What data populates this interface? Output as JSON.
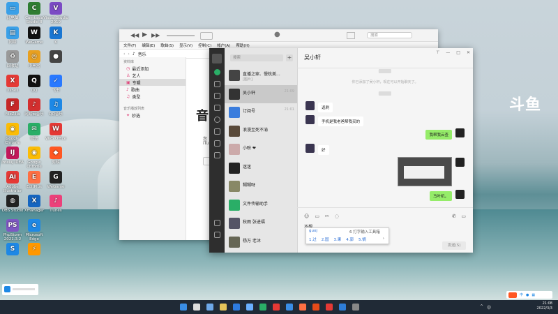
{
  "desktop": {
    "right_logo": "斗鱼",
    "icons": [
      {
        "label": "此电脑",
        "color": "#3aa0e8",
        "glyph": "▭",
        "col": 0,
        "row": 0
      },
      {
        "label": "Camtasia Studio 8",
        "color": "#2e7d32",
        "glyph": "C",
        "col": 1,
        "row": 0
      },
      {
        "label": "Visual Studio 2019",
        "color": "#7b4bc4",
        "glyph": "V",
        "col": 2,
        "row": 0
      },
      {
        "label": "网络",
        "color": "#3aa0e8",
        "glyph": "▤",
        "col": 0,
        "row": 1
      },
      {
        "label": "WeGame",
        "color": "#111",
        "glyph": "W",
        "col": 1,
        "row": 1
      },
      {
        "label": "K",
        "color": "#1976d2",
        "glyph": "K",
        "col": 2,
        "row": 1
      },
      {
        "label": "回收站",
        "color": "#999",
        "glyph": "♻",
        "col": 0,
        "row": 2
      },
      {
        "label": "小黑盒",
        "color": "#e8a020",
        "glyph": "◎",
        "col": 1,
        "row": 2
      },
      {
        "label": "",
        "color": "#444",
        "glyph": "●",
        "col": 2,
        "row": 2
      },
      {
        "label": "Xshell",
        "color": "#e53935",
        "glyph": "X",
        "col": 0,
        "row": 3
      },
      {
        "label": "QQ",
        "color": "#111",
        "glyph": "Q",
        "col": 1,
        "row": 3
      },
      {
        "label": "飞书",
        "color": "#2979ff",
        "glyph": "✓",
        "col": 2,
        "row": 3
      },
      {
        "label": "FileZilla",
        "color": "#c62828",
        "glyph": "F",
        "col": 0,
        "row": 4
      },
      {
        "label": "网易云音乐",
        "color": "#d32f2f",
        "glyph": "♪",
        "col": 1,
        "row": 4
      },
      {
        "label": "QQ音乐",
        "color": "#1e88e5",
        "glyph": "♫",
        "col": 2,
        "row": 4
      },
      {
        "label": "Google Chrome",
        "color": "#fbbc05",
        "glyph": "◉",
        "col": 0,
        "row": 5
      },
      {
        "label": "微信",
        "color": "#2aae67",
        "glyph": "✉",
        "col": 1,
        "row": 5
      },
      {
        "label": "WPS Office",
        "color": "#e53935",
        "glyph": "W",
        "col": 2,
        "row": 5
      },
      {
        "label": "IntelliJ IDEA",
        "color": "#c2185b",
        "glyph": "IJ",
        "col": 0,
        "row": 6
      },
      {
        "label": "Google Chrome",
        "color": "#fbbc05",
        "glyph": "◉",
        "col": 1,
        "row": 6
      },
      {
        "label": "剪映",
        "color": "#ff5722",
        "glyph": "◆",
        "col": 2,
        "row": 6
      },
      {
        "label": "Adobe Illustrator",
        "color": "#e53935",
        "glyph": "Ai",
        "col": 0,
        "row": 7
      },
      {
        "label": "EditPlus",
        "color": "#ff7043",
        "glyph": "E",
        "col": 1,
        "row": 7
      },
      {
        "label": "WeGame",
        "color": "#222",
        "glyph": "G",
        "col": 2,
        "row": 7
      },
      {
        "label": "OBS Studio",
        "color": "#222",
        "glyph": "◍",
        "col": 0,
        "row": 8
      },
      {
        "label": "Xmanager",
        "color": "#1565c0",
        "glyph": "X",
        "col": 1,
        "row": 8
      },
      {
        "label": "iTunes",
        "color": "#ec407a",
        "glyph": "♪",
        "col": 2,
        "row": 8
      },
      {
        "label": "PhpStorm 2021.3.2",
        "color": "#7e57c2",
        "glyph": "PS",
        "col": 0,
        "row": 9
      },
      {
        "label": "Microsoft Edge",
        "color": "#1e88e5",
        "glyph": "e",
        "col": 1,
        "row": 9
      },
      {
        "label": "",
        "color": "#1e88e5",
        "glyph": "S",
        "col": 0,
        "row": 10
      },
      {
        "label": "",
        "color": "#ff9800",
        "glyph": "⚡",
        "col": 1,
        "row": 10
      }
    ]
  },
  "itunes": {
    "menu": [
      "文件(F)",
      "编辑(E)",
      "歌曲(S)",
      "显示(V)",
      "控制(C)",
      "帐户(A)",
      "帮助(H)"
    ],
    "nav_dropdown": "音乐",
    "search_placeholder": "搜索",
    "library_header": "资料库",
    "library_items": [
      "最近添加",
      "艺人",
      "专辑",
      "歌曲",
      "类型"
    ],
    "playlists_header": "音乐播放列表",
    "playlist_items": [
      "妙选"
    ],
    "selected": "专辑",
    "main_heading": "音",
    "main_sub1": "您",
    "main_sub2": "iTu"
  },
  "wechat": {
    "search_placeholder": "搜索",
    "chat_list": [
      {
        "name": "直播之家、慢枕美...",
        "preview": "[图片]",
        "time": "",
        "color": "#444"
      },
      {
        "name": "吴小轩",
        "preview": "",
        "time": "21:09",
        "color": "#333",
        "selected": true
      },
      {
        "name": "订阅号",
        "preview": "",
        "time": "21:01",
        "color": "#3b7ddd"
      },
      {
        "name": "浪漫至死不渝",
        "preview": "",
        "time": "",
        "color": "#5a4a3a"
      },
      {
        "name": "小盼 ❤",
        "preview": "",
        "time": "",
        "color": "#caa"
      },
      {
        "name": "迷迷",
        "preview": "",
        "time": "",
        "color": "#222"
      },
      {
        "name": "糊糊呀",
        "preview": "",
        "time": "",
        "color": "#886"
      },
      {
        "name": "文件传输助手",
        "preview": "",
        "time": "",
        "color": "#2aae67"
      },
      {
        "name": "秋雨 张进福",
        "preview": "",
        "time": "",
        "color": "#556"
      },
      {
        "name": "杨万 老沐",
        "preview": "",
        "time": "",
        "color": "#665"
      }
    ],
    "chat_title": "吴小轩",
    "system_notice": "你已添加了吴小轩，现在可以开始聊天了。",
    "messages": [
      {
        "side": "left",
        "text": "返刷"
      },
      {
        "side": "left",
        "text": "手机是我老爸帮我买的"
      },
      {
        "side": "right",
        "text": "我帮我云查"
      },
      {
        "side": "left",
        "text": "好"
      },
      {
        "side": "right",
        "text": "马叶机，"
      }
    ],
    "input_text": "不想",
    "send_label": "发送(S)"
  },
  "ime": {
    "pinyin": "guoj",
    "hint": "6 打字输入工具箱",
    "candidates": [
      "1.过",
      "2.国",
      "3.果",
      "4.郭",
      "5.锅"
    ],
    "more": "›"
  },
  "taskbar": {
    "time": "21:08",
    "date": "2022/3/3",
    "lang": "中"
  }
}
